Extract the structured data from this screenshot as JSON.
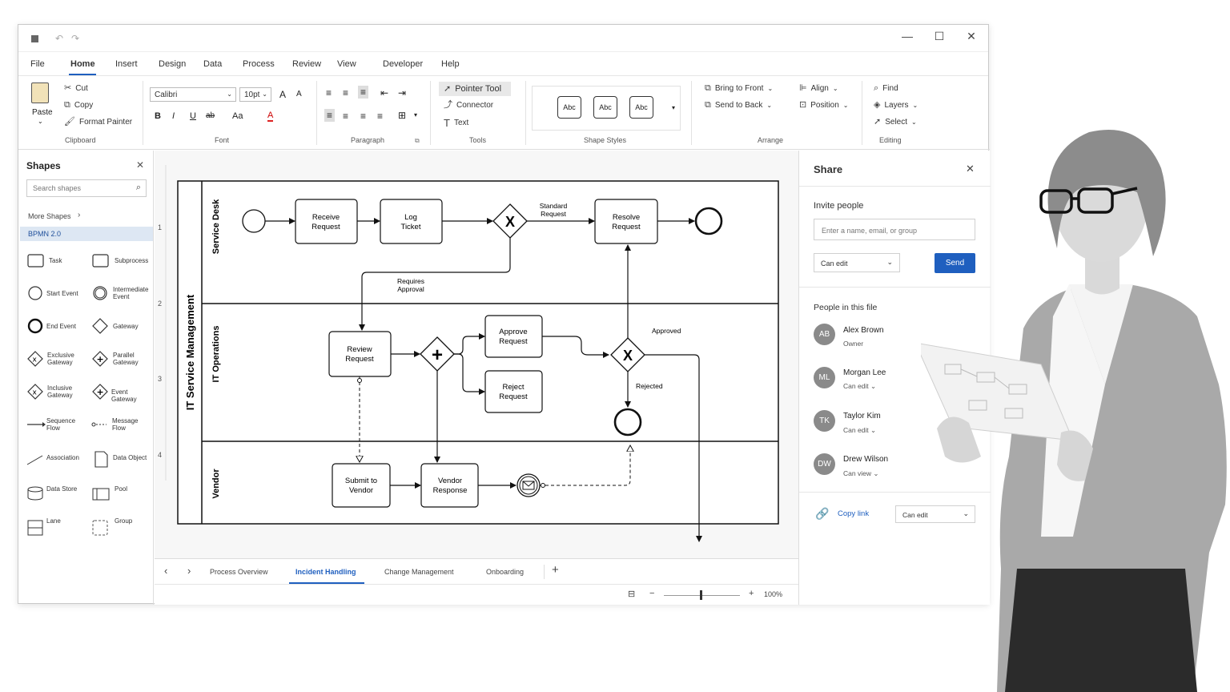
{
  "window": {
    "minimize": "—",
    "maximize": "☐",
    "close": "✕"
  },
  "menu": [
    "File",
    "Home",
    "Insert",
    "Design",
    "Data",
    "Process",
    "Review",
    "View",
    "Developer",
    "Help"
  ],
  "ribbon": {
    "clipboard": {
      "paste": "Paste",
      "cut": "Cut",
      "copy": "Copy",
      "format_painter": "Format Painter",
      "label": "Clipboard"
    },
    "font": {
      "family": "Calibri",
      "size": "10pt",
      "grow": "A",
      "shrink": "A",
      "bold": "B",
      "italic": "I",
      "underline": "U",
      "strike": "ab",
      "case": "Aa",
      "color": "A",
      "label": "Font"
    },
    "paragraph": {
      "label": "Paragraph"
    },
    "tools": {
      "pointer": "Pointer Tool",
      "connector": "Connector",
      "text": "Text",
      "label": "Tools"
    },
    "shape_styles": {
      "items": [
        "Abc",
        "Abc",
        "Abc"
      ],
      "label": "Shape Styles"
    },
    "arrange": {
      "bring_front": "Bring to Front",
      "send_back": "Send to Back",
      "align": "Align",
      "position": "Position",
      "label": "Arrange"
    },
    "editing": {
      "find": "Find",
      "layers": "Layers",
      "select": "Select",
      "label": "Editing"
    }
  },
  "shapes_panel": {
    "title": "Shapes",
    "search_placeholder": "Search shapes",
    "more_shapes": "More Shapes",
    "category": "BPMN 2.0",
    "items": [
      "Task",
      "Subprocess",
      "Start Event",
      "Intermediate Event",
      "End Event",
      "Gateway",
      "Exclusive Gateway",
      "Parallel Gateway",
      "Inclusive Gateway",
      "Event Gateway",
      "Sequence Flow",
      "Message Flow",
      "Association",
      "Data Object",
      "Data Store",
      "Pool",
      "Lane",
      "Group"
    ]
  },
  "diagram": {
    "pool": "IT Service Management",
    "lanes": [
      "Service Desk",
      "IT Operations",
      "Vendor"
    ],
    "ruler": [
      "1",
      "2",
      "3",
      "4"
    ],
    "tasks": {
      "receive": [
        "Receive",
        "Request"
      ],
      "log": [
        "Log",
        "Ticket"
      ],
      "resolve": [
        "Resolve",
        "Request"
      ],
      "review": [
        "Review",
        "Request"
      ],
      "approve": [
        "Approve",
        "Request"
      ],
      "reject": [
        "Reject",
        "Request"
      ],
      "submit": [
        "Submit to",
        "Vendor"
      ],
      "vendor": [
        "Vendor",
        "Response"
      ]
    },
    "labels": {
      "standard": [
        "Standard",
        "Request"
      ],
      "requires": [
        "Requires",
        "Approval"
      ],
      "approved": "Approved",
      "rejected": "Rejected"
    },
    "gateway_x": "X",
    "gateway_plus": "+"
  },
  "page_tabs": [
    "Process Overview",
    "Incident Handling",
    "Change Management",
    "Onboarding"
  ],
  "add_tab": "+",
  "status": {
    "zoom": "100%",
    "minus": "−",
    "plus": "+"
  },
  "share": {
    "title": "Share",
    "invite_label": "Invite people",
    "invite_placeholder": "Enter a name, email, or group",
    "permission": "Can edit",
    "send": "Send",
    "people_label": "People in this file",
    "people": [
      {
        "initials": "AB",
        "name": "Alex Brown",
        "role": "Owner"
      },
      {
        "initials": "ML",
        "name": "Morgan Lee",
        "role": "Can edit"
      },
      {
        "initials": "TK",
        "name": "Taylor Kim",
        "role": "Can edit"
      },
      {
        "initials": "DW",
        "name": "Drew Wilson",
        "role": "Can view"
      }
    ],
    "copy_link": "Copy link",
    "link_permission": "Can edit"
  }
}
